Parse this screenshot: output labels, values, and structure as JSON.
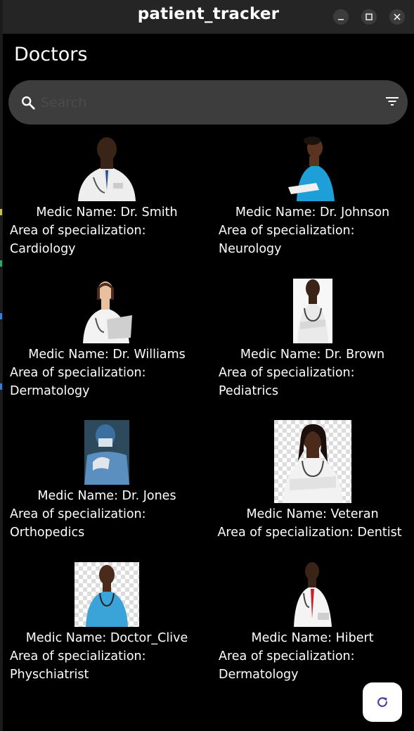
{
  "window": {
    "title": "patient_tracker"
  },
  "page": {
    "title": "Doctors"
  },
  "search": {
    "placeholder": "Search"
  },
  "doctors": [
    {
      "name": "Medic Name: Dr. Smith",
      "specialization": "Area of specialization: Cardiology"
    },
    {
      "name": "Medic Name: Dr. Johnson",
      "specialization": "Area of specialization: Neurology"
    },
    {
      "name": "Medic Name: Dr. Williams",
      "specialization": "Area of specialization: Dermatology"
    },
    {
      "name": "Medic Name: Dr. Brown",
      "specialization": "Area of specialization: Pediatrics"
    },
    {
      "name": "Medic Name: Dr. Jones",
      "specialization": "Area of specialization: Orthopedics"
    },
    {
      "name": "Medic Name: Veteran",
      "specialization": "Area of specialization: Dentist"
    },
    {
      "name": "Medic Name: Doctor_Clive",
      "specialization": "Area of specialization: Physchiatrist"
    },
    {
      "name": "Medic Name: Hibert",
      "specialization": "Area of specialization: Dermatology"
    }
  ],
  "icons": {
    "search": "search-icon",
    "filter": "filter-icon",
    "refresh": "refresh-icon",
    "minimize": "minimize-icon",
    "maximize": "maximize-icon",
    "close": "close-icon"
  },
  "colors": {
    "background": "#000000",
    "titlebar": "#252525",
    "search_bar": "#3d3d3d",
    "fab_icon": "#4a3f9a"
  }
}
